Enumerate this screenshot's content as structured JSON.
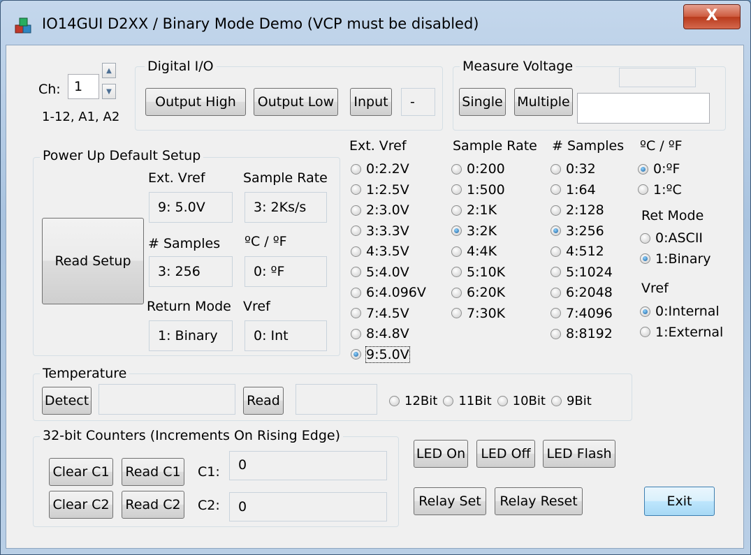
{
  "window": {
    "title": "IO14GUI  D2XX / Binary Mode Demo (VCP must be disabled)",
    "close_label": "X"
  },
  "channel": {
    "label": "Ch:",
    "value": "1",
    "range_hint": "1-12, A1, A2"
  },
  "digital_io": {
    "title": "Digital I/O",
    "output_high": "Output High",
    "output_low": "Output Low",
    "input": "Input",
    "input_value": "-"
  },
  "measure_voltage": {
    "title": "Measure Voltage",
    "single": "Single",
    "multiple": "Multiple",
    "status_value": "",
    "result_value": ""
  },
  "power_up": {
    "title": "Power Up Default Setup",
    "read_setup": "Read Setup",
    "ext_vref_label": "Ext. Vref",
    "ext_vref_value": "9: 5.0V",
    "sample_rate_label": "Sample Rate",
    "sample_rate_value": "3: 2Ks/s",
    "samples_label": "# Samples",
    "samples_value": "3: 256",
    "temp_unit_label": "ºC / ºF",
    "temp_unit_value": "0: ºF",
    "return_mode_label": "Return Mode",
    "return_mode_value": "1: Binary",
    "vref_label": "Vref",
    "vref_value": "0: Int"
  },
  "ext_vref": {
    "title": "Ext. Vref",
    "options": [
      "0:2.2V",
      "1:2.5V",
      "2:3.0V",
      "3:3.3V",
      "4:3.5V",
      "5:4.0V",
      "6:4.096V",
      "7:4.5V",
      "8:4.8V",
      "9:5.0V"
    ],
    "selected": 9
  },
  "sample_rate": {
    "title": "Sample Rate",
    "options": [
      "0:200",
      "1:500",
      "2:1K",
      "3:2K",
      "4:4K",
      "5:10K",
      "6:20K",
      "7:30K"
    ],
    "selected": 3
  },
  "samples": {
    "title": "# Samples",
    "options": [
      "0:32",
      "1:64",
      "2:128",
      "3:256",
      "4:512",
      "5:1024",
      "6:2048",
      "7:4096",
      "8:8192"
    ],
    "selected": 3
  },
  "temp_unit": {
    "title": "ºC / ºF",
    "options": [
      "0:ºF",
      "1:ºC"
    ],
    "selected": 0
  },
  "ret_mode": {
    "title": "Ret Mode",
    "options": [
      "0:ASCII",
      "1:Binary"
    ],
    "selected": 1
  },
  "vref": {
    "title": "Vref",
    "options": [
      "0:Internal",
      "1:External"
    ],
    "selected": 0
  },
  "temperature": {
    "title": "Temperature",
    "detect": "Detect",
    "detect_value": "",
    "read": "Read",
    "read_value": "",
    "resolutions": [
      "12Bit",
      "11Bit",
      "10Bit",
      "9Bit"
    ]
  },
  "counters": {
    "title": "32-bit Counters (Increments On Rising Edge)",
    "clear_c1": "Clear C1",
    "read_c1": "Read C1",
    "c1_label": "C1:",
    "c1_value": "0",
    "clear_c2": "Clear C2",
    "read_c2": "Read C2",
    "c2_label": "C2:",
    "c2_value": "0"
  },
  "controls": {
    "led_on": "LED On",
    "led_off": "LED Off",
    "led_flash": "LED Flash",
    "relay_set": "Relay Set",
    "relay_reset": "Relay Reset",
    "exit": "Exit"
  }
}
